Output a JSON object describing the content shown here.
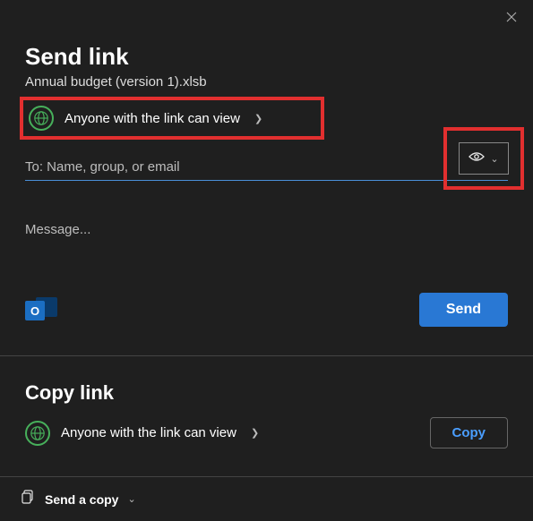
{
  "dialog": {
    "title": "Send link",
    "filename": "Annual budget (version 1).xlsb"
  },
  "permission": {
    "text": "Anyone with the link can view"
  },
  "to": {
    "placeholder": "To: Name, group, or email"
  },
  "message": {
    "placeholder": "Message..."
  },
  "buttons": {
    "send": "Send",
    "copy": "Copy",
    "send_a_copy": "Send a copy"
  },
  "copy_link": {
    "title": "Copy link",
    "permission_text": "Anyone with the link can view"
  },
  "icons": {
    "outlook_letter": "O"
  }
}
